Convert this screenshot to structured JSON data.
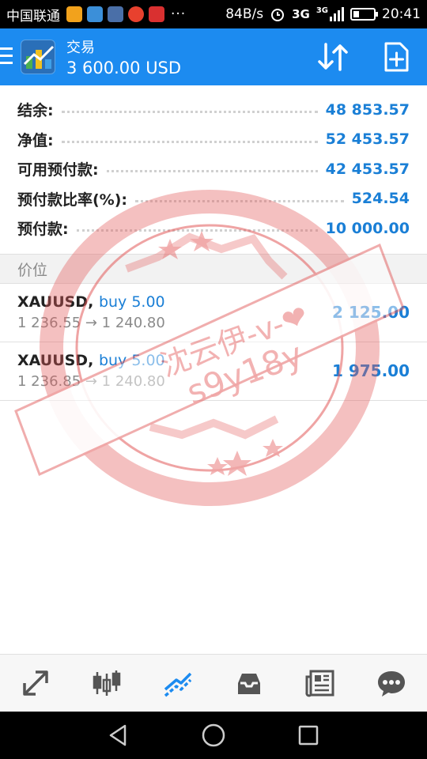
{
  "status_bar": {
    "carrier": "中国联通",
    "overflow_indicator": "···",
    "net_speed": "84B/s",
    "network_3g_a": "3G",
    "network_3g_b": "3G",
    "time": "20:41"
  },
  "app_bar": {
    "title": "交易",
    "subtitle": "3 600.00 USD"
  },
  "summary": [
    {
      "label": "结余:",
      "value": "48 853.57"
    },
    {
      "label": "净值:",
      "value": "52 453.57"
    },
    {
      "label": "可用预付款:",
      "value": "42 453.57"
    },
    {
      "label": "预付款比率(%):",
      "value": "524.54"
    },
    {
      "label": "预付款:",
      "value": "10 000.00"
    }
  ],
  "section_header": "价位",
  "positions": [
    {
      "symbol": "XAUUSD",
      "direction": "buy 5.00",
      "prices": "1 236.55 → 1 240.80",
      "profit": "2 125.00"
    },
    {
      "symbol": "XAUUSD",
      "direction": "buy 5.00",
      "prices": "1 236.85 → 1 240.80",
      "profit": "1 975.00"
    }
  ],
  "watermark": {
    "line1": "沈云伊-v-❤",
    "line2": "s9y18y"
  },
  "tabs": [
    {
      "icon": "trade-arrows-icon"
    },
    {
      "icon": "candlestick-icon"
    },
    {
      "icon": "chart-trend-icon",
      "active": true
    },
    {
      "icon": "inbox-icon"
    },
    {
      "icon": "news-icon"
    },
    {
      "icon": "chat-icon"
    }
  ],
  "colors": {
    "app_bar": "#1c8bf0",
    "value_blue": "#1a7fd6",
    "stamp_red": "#e35a5a",
    "active_tab": "#1c8bf0",
    "inactive_tab": "#555555"
  }
}
